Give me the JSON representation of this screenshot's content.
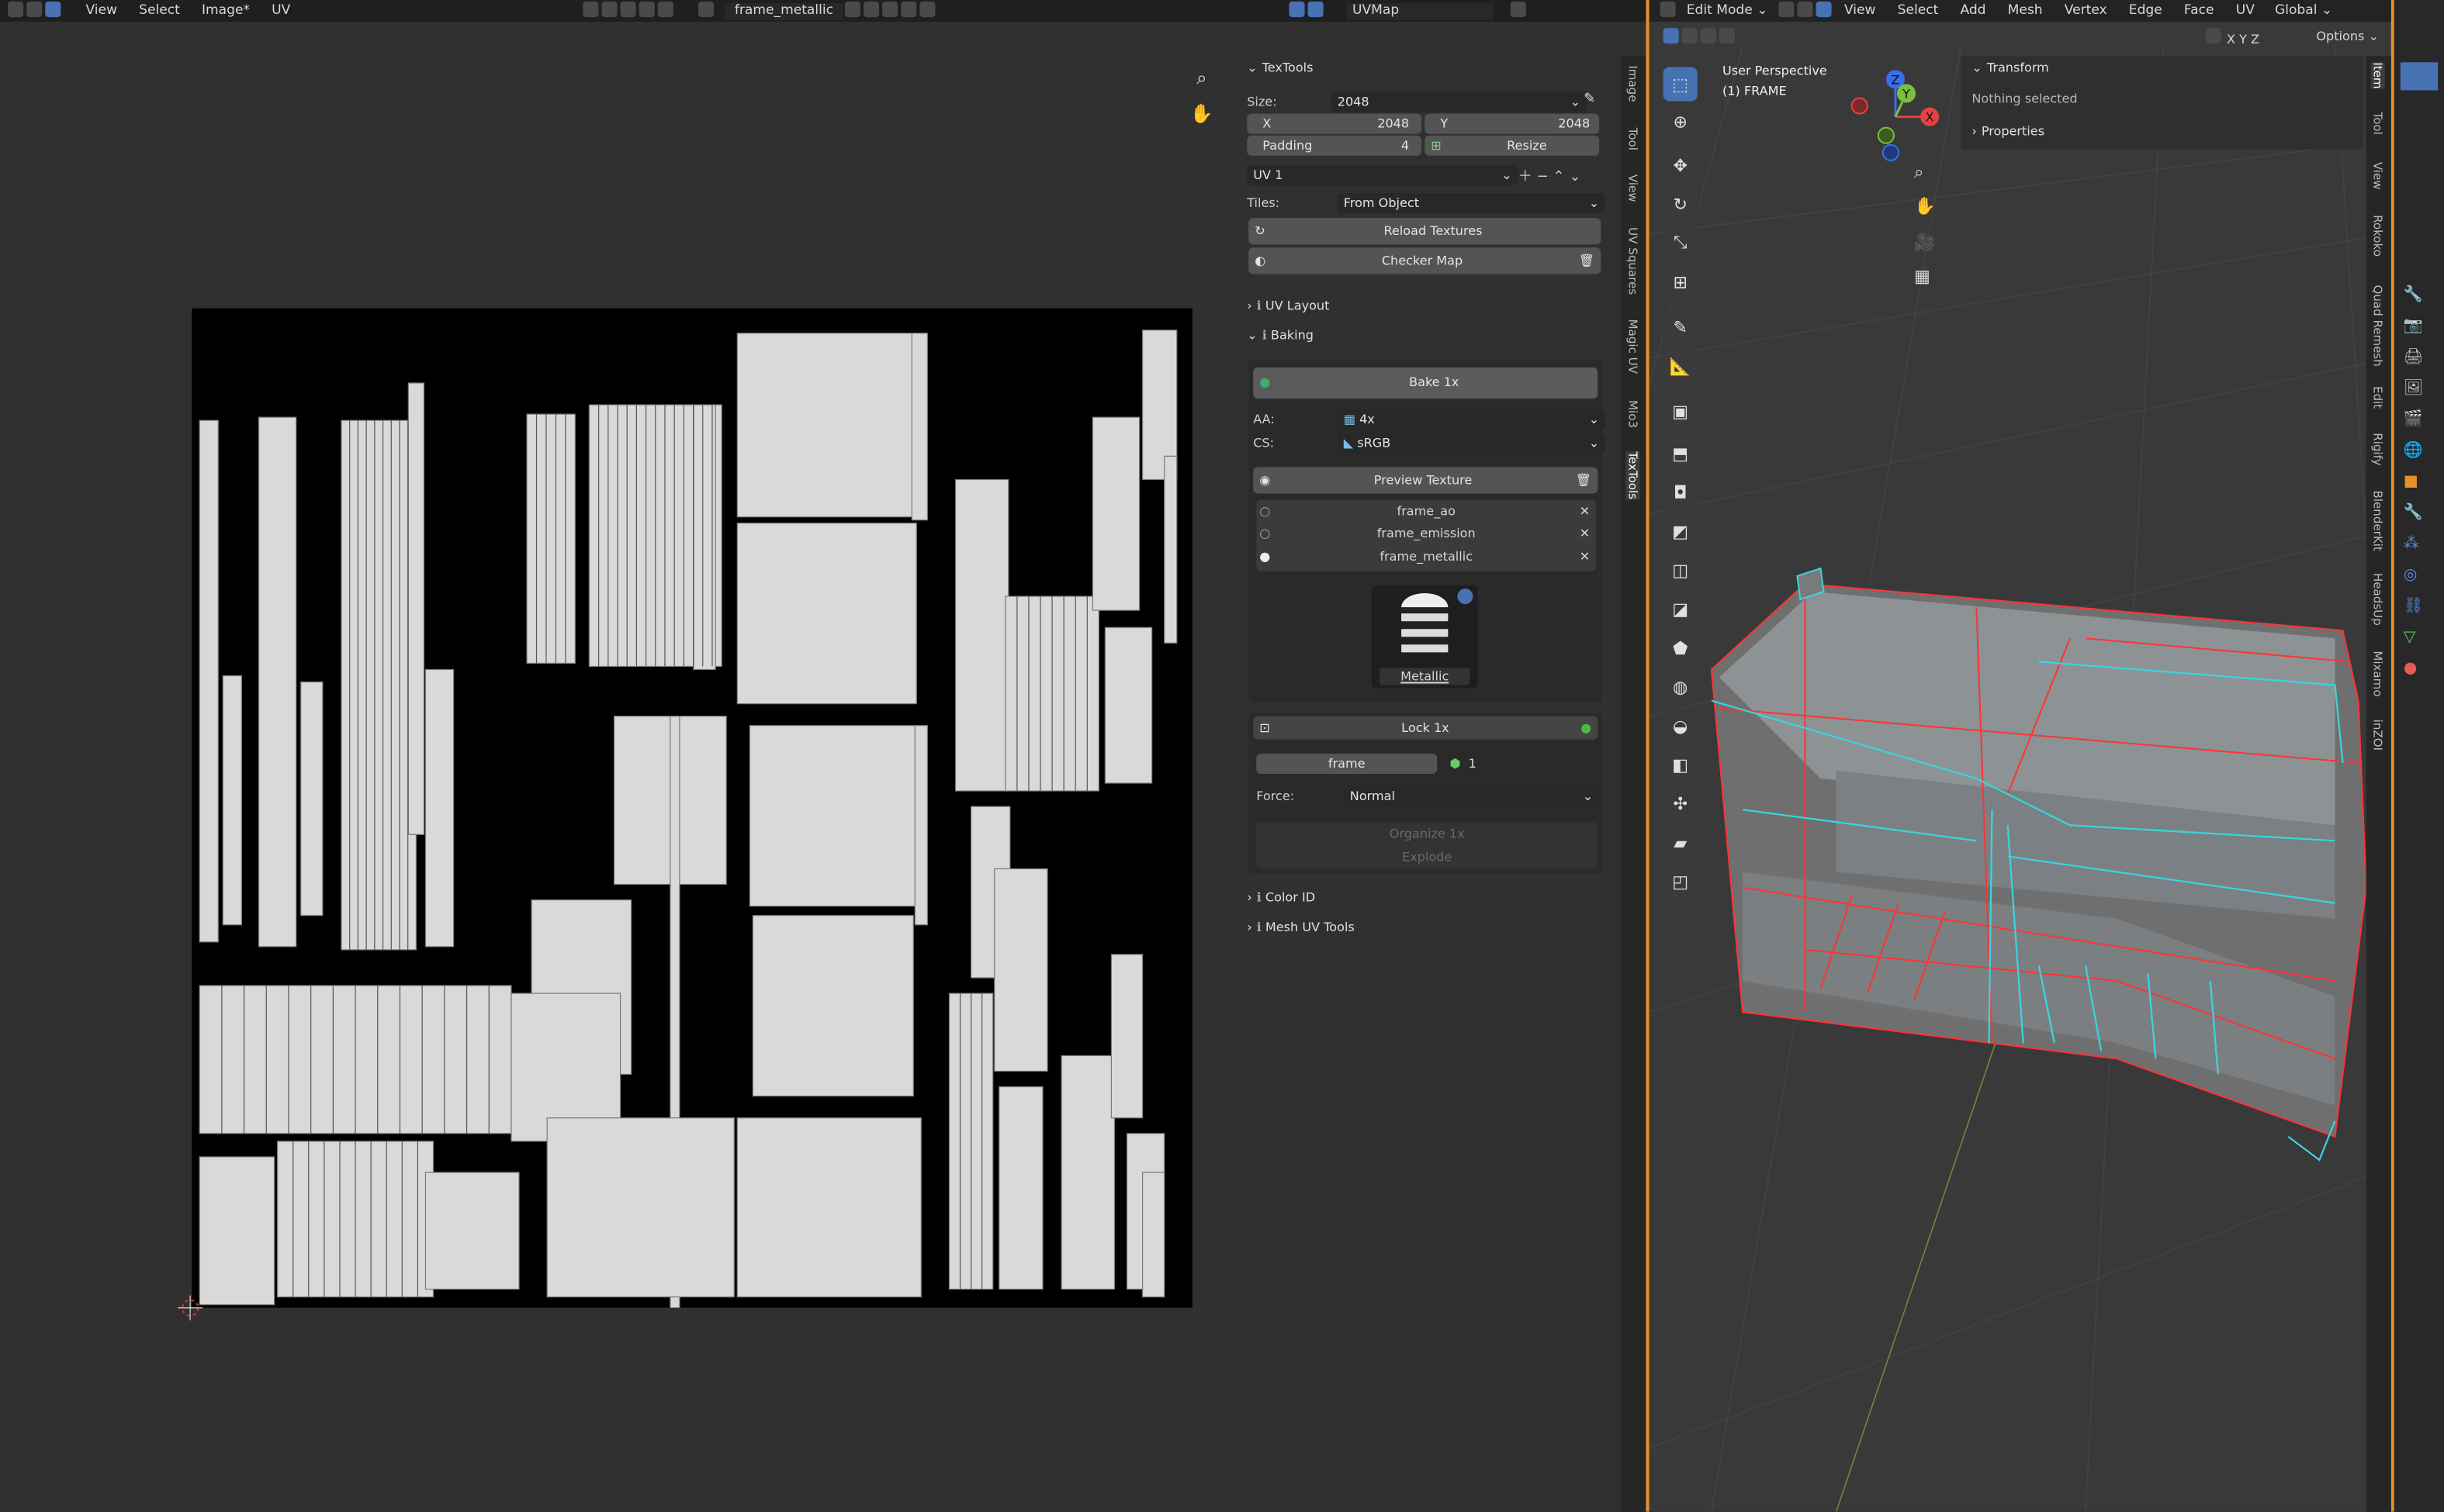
{
  "uv_editor": {
    "menus": [
      "View",
      "Select",
      "Image*",
      "UV"
    ],
    "image_name": "frame_metallic",
    "uv_map_name": "UVMap"
  },
  "viewport": {
    "mode": "Edit Mode",
    "menus": [
      "View",
      "Select",
      "Add",
      "Mesh",
      "Vertex",
      "Edge",
      "Face",
      "UV"
    ],
    "orientation": "Global",
    "axes": [
      "X",
      "Y",
      "Z"
    ],
    "options": "Options",
    "view_name": "User Perspective",
    "object_name": "(1) FRAME",
    "gizmo": {
      "x": "X",
      "y": "Y",
      "z": "Z"
    }
  },
  "n_panel": {
    "transform_header": "Transform",
    "nothing_selected": "Nothing selected",
    "properties_header": "Properties",
    "tabs": [
      "Item",
      "Tool",
      "View",
      "Rokoko",
      "Quad Remesh",
      "Edit",
      "Rigify",
      "BlenderKit",
      "HeadsUp",
      "Mixamo",
      "inZOI"
    ]
  },
  "uv_tabs": [
    "Image",
    "Tool",
    "View",
    "UV Squares",
    "Magic UV",
    "Mio3",
    "TexTools"
  ],
  "textools": {
    "header": "TexTools",
    "size_label": "Size:",
    "size_value": "2048",
    "x_label": "X",
    "x_value": "2048",
    "y_label": "Y",
    "y_value": "2048",
    "padding_label": "Padding",
    "padding_value": "4",
    "resize_label": "Resize",
    "uv_channel": "UV 1",
    "tiles_label": "Tiles:",
    "tiles_value": "From Object",
    "reload_label": "Reload Textures",
    "checker_label": "Checker Map",
    "uv_layout_header": "UV Layout",
    "baking_header": "Baking",
    "bake_label": "Bake 1x",
    "aa_label": "AA:",
    "aa_value": "4x",
    "cs_label": "CS:",
    "cs_value": "sRGB",
    "preview_label": "Preview Texture",
    "textures": [
      "frame_ao",
      "frame_emission",
      "frame_metallic"
    ],
    "thumb_label": "Metallic",
    "lock_label": "Lock 1x",
    "object_name": "frame",
    "object_count": "1",
    "force_label": "Force:",
    "force_value": "Normal",
    "organize_label": "Organize 1x",
    "explode_label": "Explode",
    "color_id_header": "Color ID",
    "mesh_uv_header": "Mesh UV Tools"
  },
  "colors": {
    "accent": "#4772b3",
    "edit_border": "#e8902e",
    "selected_edge": "#ff2f2f",
    "seam": "#38d5e0"
  }
}
